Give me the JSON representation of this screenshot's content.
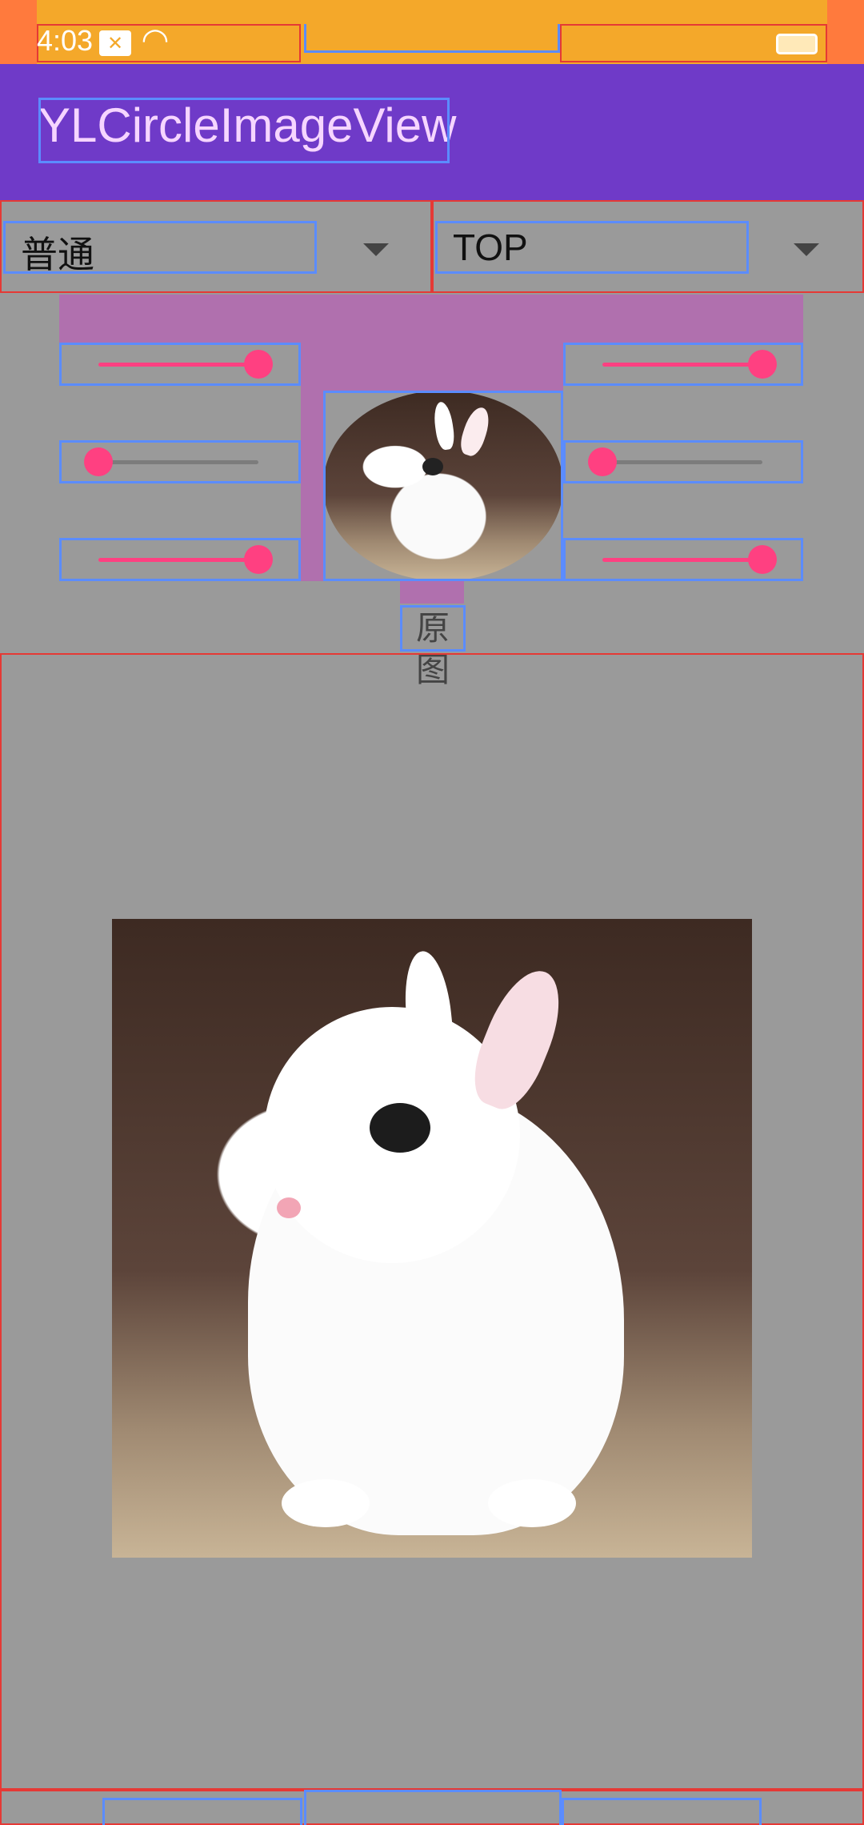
{
  "status_bar": {
    "time": "4:03",
    "icons": [
      "notification-x-icon",
      "wifi-icon",
      "battery-icon"
    ],
    "notification_glyph": "✕",
    "wifi_glyph": "◠"
  },
  "app_bar": {
    "title": "YLCircleImageView"
  },
  "spinners": {
    "left": {
      "selected": "普通"
    },
    "right": {
      "selected": "TOP"
    }
  },
  "sliders": {
    "left": [
      {
        "value": 1.0
      },
      {
        "value": 0.0
      },
      {
        "value": 1.0
      }
    ],
    "right": [
      {
        "value": 1.0
      },
      {
        "value": 0.0
      },
      {
        "value": 1.0
      }
    ]
  },
  "preview": {
    "caption": "原图"
  },
  "colors": {
    "status_bar": "#f4a82a",
    "app_bar": "#6f3ac8",
    "accent": "#ff4081",
    "panel": "#b070ae",
    "background": "#9a9a9a"
  }
}
